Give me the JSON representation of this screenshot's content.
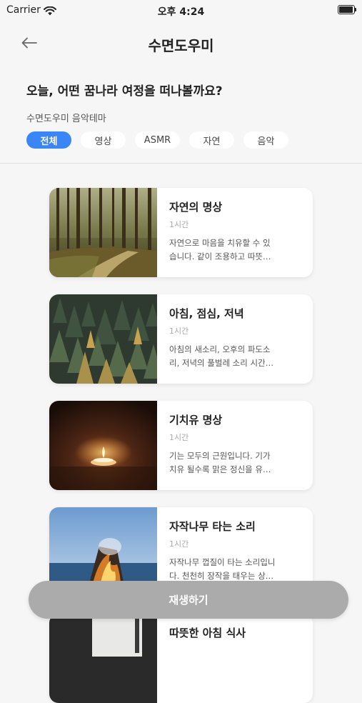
{
  "status_bar": {
    "carrier": "Carrier",
    "time": "오후 4:24"
  },
  "nav": {
    "title": "수면도우미"
  },
  "question": "오늘, 어떤 꿈나라 여정을 떠나볼까요?",
  "theme_label": "수면도우미 음악테마",
  "categories": [
    "전체",
    "영상",
    "ASMR",
    "자연",
    "음악"
  ],
  "selected_category": "전체",
  "cards": [
    {
      "title": "자연의 명상",
      "duration": "1시간",
      "desc_line1": "자연으로 마음을 치유할 수 있",
      "desc_line2": "습니다. 같이 조용하고 따뜻…",
      "thumb": "forest-path"
    },
    {
      "title": "아침, 점심, 저녁",
      "duration": "1시간",
      "desc_line1": "아침의 새소리, 오후의 파도소",
      "desc_line2": "리, 저녁의 풀벌레 소리 시간…",
      "thumb": "pine-forest"
    },
    {
      "title": "기치유 명상",
      "duration": "1시간",
      "desc_line1": "기는 모두의 근원입니다. 기가",
      "desc_line2": "치유 될수록 맑은 정신을 유…",
      "thumb": "candle"
    },
    {
      "title": "자작나무 타는 소리",
      "duration": "1시간",
      "desc_line1": "자작나무 껍질이 타는 소리입니",
      "desc_line2": "다. 천천히 장작을 태우는 상…",
      "thumb": "campfire"
    },
    {
      "title": "따뜻한 아침 식사",
      "thumb": "breakfast"
    }
  ],
  "play_button": "재생하기",
  "colors": {
    "accent": "#3b86f6",
    "background": "#f6f6f6",
    "play_button": "#ababab"
  }
}
